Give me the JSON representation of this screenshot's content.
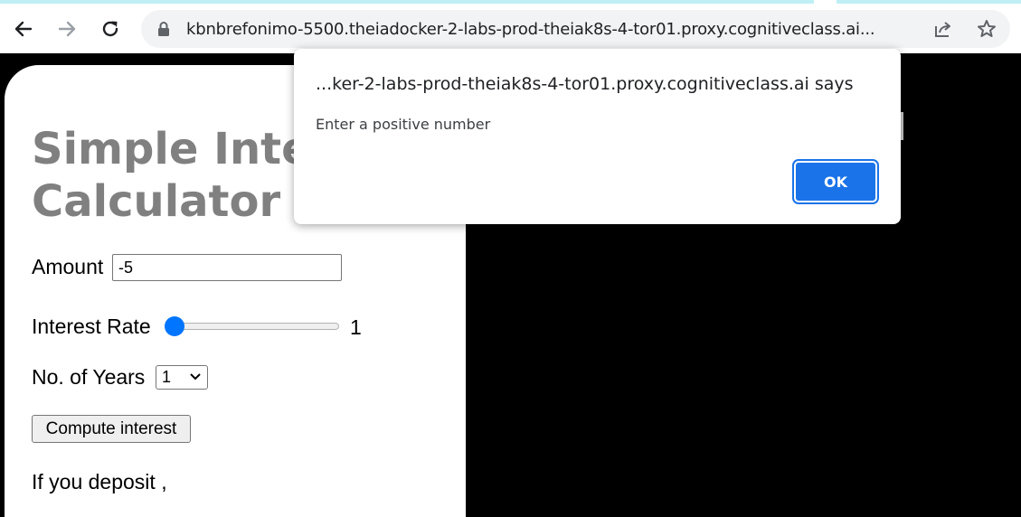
{
  "browser": {
    "url": "kbnbrefonimo-5500.theiadocker-2-labs-prod-theiak8s-4-tor01.proxy.cognitiveclass.ai..."
  },
  "page": {
    "title": "Simple Interest Calculator",
    "amount_label": "Amount",
    "amount_value": "-5",
    "rate_label": "Interest Rate",
    "rate_value": "1",
    "years_label": "No. of Years",
    "years_selected": "1",
    "compute_label": "Compute interest",
    "result_text": "If you deposit ,"
  },
  "dialog": {
    "title": "...ker-2-labs-prod-theiak8s-4-tor01.proxy.cognitiveclass.ai says",
    "message": "Enter a positive number",
    "ok_label": "OK"
  },
  "colors": {
    "dialog_button": "#1a73e8",
    "slider_thumb": "#0075ff",
    "title_text": "#808080"
  }
}
